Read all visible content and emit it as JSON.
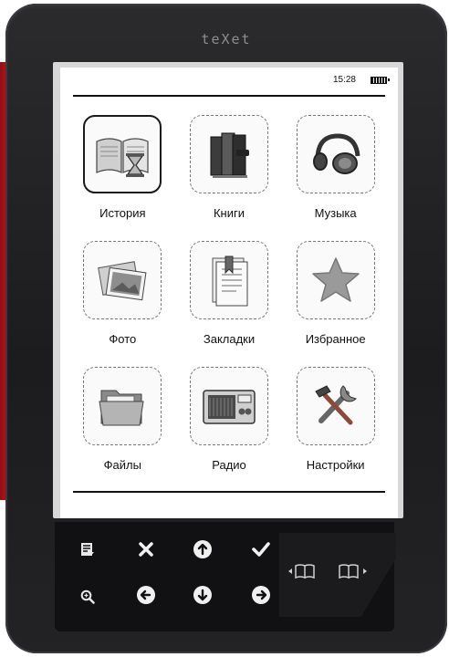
{
  "device": {
    "brand": "teXet"
  },
  "status_bar": {
    "time": "15:28"
  },
  "menu": {
    "items": [
      {
        "label": "История",
        "icon": "history-book-hourglass-icon",
        "selected": true
      },
      {
        "label": "Книги",
        "icon": "books-icon",
        "selected": false
      },
      {
        "label": "Музыка",
        "icon": "headphones-icon",
        "selected": false
      },
      {
        "label": "Фото",
        "icon": "photos-icon",
        "selected": false
      },
      {
        "label": "Закладки",
        "icon": "bookmark-document-icon",
        "selected": false
      },
      {
        "label": "Избранное",
        "icon": "star-icon",
        "selected": false
      },
      {
        "label": "Файлы",
        "icon": "folder-icon",
        "selected": false
      },
      {
        "label": "Радио",
        "icon": "radio-icon",
        "selected": false
      },
      {
        "label": "Настройки",
        "icon": "tools-icon",
        "selected": false
      }
    ]
  },
  "hardware_buttons": [
    {
      "name": "menu-button",
      "icon": "list-icon"
    },
    {
      "name": "zoom-button",
      "icon": "zoom-icon"
    },
    {
      "name": "close-button",
      "icon": "x-icon"
    },
    {
      "name": "left-button",
      "icon": "arrow-left-icon"
    },
    {
      "name": "up-button",
      "icon": "arrow-up-icon"
    },
    {
      "name": "down-button",
      "icon": "arrow-down-icon"
    },
    {
      "name": "ok-button",
      "icon": "checkmark-icon"
    },
    {
      "name": "right-button",
      "icon": "arrow-right-icon"
    },
    {
      "name": "prev-page-button",
      "icon": "book-prev-icon"
    },
    {
      "name": "next-page-button",
      "icon": "book-next-icon"
    }
  ],
  "colors": {
    "accent_red": "#c4161f",
    "body": "#1f1f21",
    "screen": "#ffffff"
  }
}
